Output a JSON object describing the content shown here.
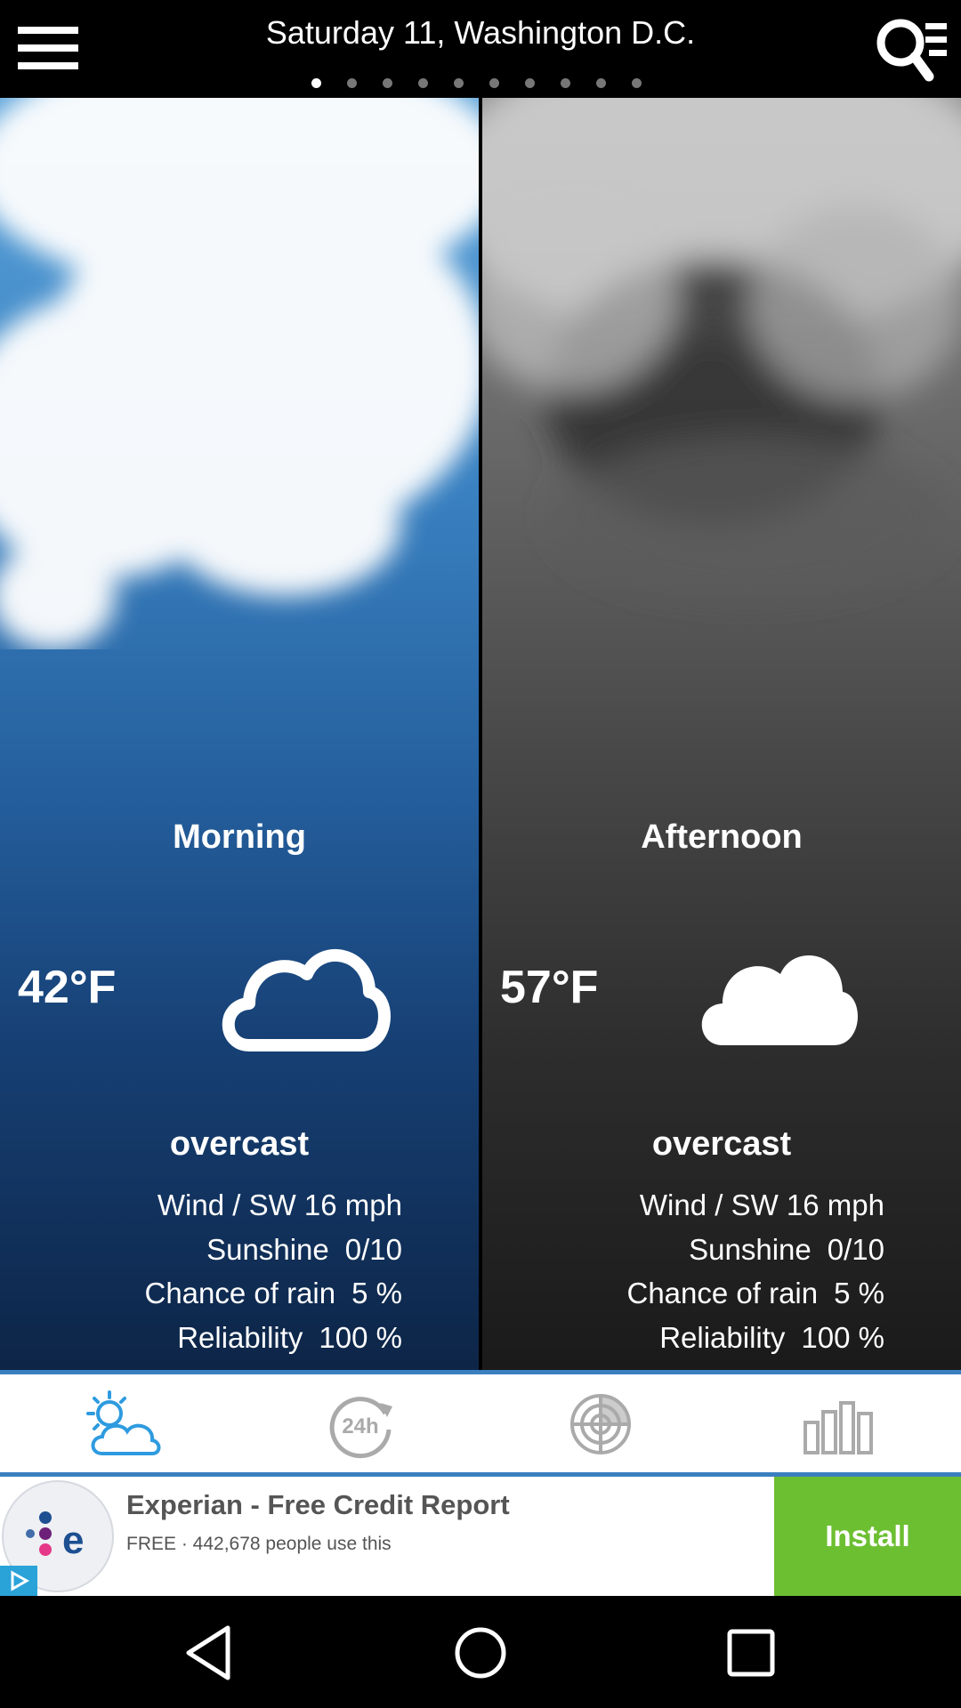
{
  "header": {
    "title": "Saturday 11, Washington D.C.",
    "page_dots_count": 10,
    "active_dot": 0
  },
  "panels": [
    {
      "period": "Morning",
      "temp": "42°F",
      "icon": "cloud-outline-icon",
      "condition": "overcast",
      "stats": [
        {
          "label": "Wind / SW",
          "value": "16 mph"
        },
        {
          "label": "Sunshine",
          "value": "0/10"
        },
        {
          "label": "Chance of rain",
          "value": "5 %"
        },
        {
          "label": "Reliability",
          "value": "100 %"
        }
      ]
    },
    {
      "period": "Afternoon",
      "temp": "57°F",
      "icon": "cloud-filled-icon",
      "condition": "overcast",
      "stats": [
        {
          "label": "Wind / SW",
          "value": "16 mph"
        },
        {
          "label": "Sunshine",
          "value": "0/10"
        },
        {
          "label": "Chance of rain",
          "value": "5 %"
        },
        {
          "label": "Reliability",
          "value": "100 %"
        }
      ]
    }
  ],
  "tabs": [
    {
      "name": "partly-cloudy-icon",
      "active": true
    },
    {
      "name": "24h-icon",
      "active": false
    },
    {
      "name": "radar-icon",
      "active": false
    },
    {
      "name": "bar-chart-icon",
      "active": false
    }
  ],
  "ad": {
    "title": "Experian - Free Credit Report",
    "subtitle": "FREE · 442,678 people use this",
    "install_label": "Install"
  },
  "colors": {
    "accent": "#3a7fbf",
    "install": "#6cbf31"
  }
}
